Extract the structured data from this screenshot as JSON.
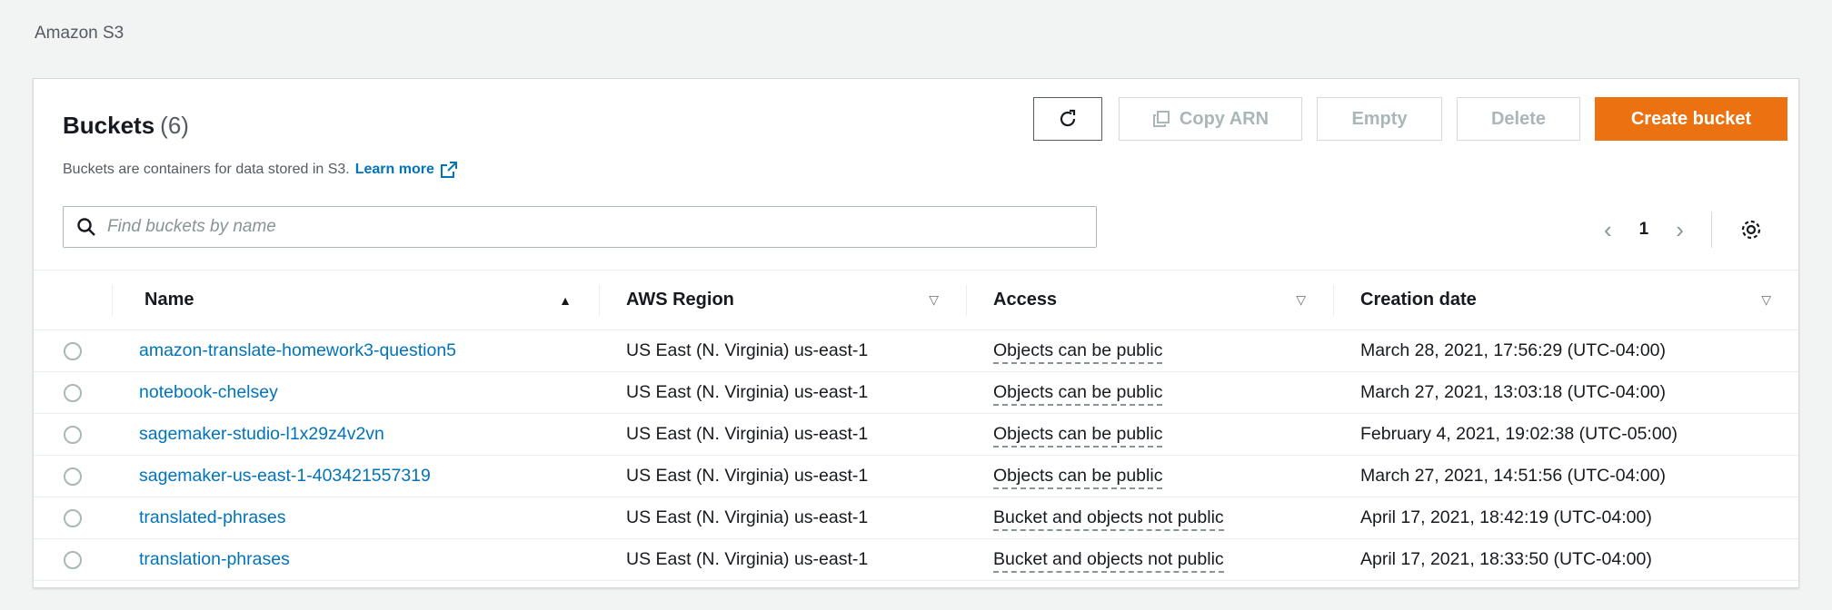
{
  "breadcrumb": "Amazon S3",
  "header": {
    "title": "Buckets",
    "count": "(6)",
    "description": "Buckets are containers for data stored in S3.",
    "learn_more": "Learn more"
  },
  "toolbar": {
    "refresh_icon": "refresh-icon",
    "copy_arn_label": "Copy ARN",
    "empty_label": "Empty",
    "delete_label": "Delete",
    "create_label": "Create bucket"
  },
  "search": {
    "placeholder": "Find buckets by name",
    "value": ""
  },
  "pagination": {
    "current_page": "1"
  },
  "table": {
    "columns": [
      "Name",
      "AWS Region",
      "Access",
      "Creation date"
    ],
    "rows": [
      {
        "name": "amazon-translate-homework3-question5",
        "region": "US East (N. Virginia) us-east-1",
        "access": "Objects can be public",
        "created": "March 28, 2021, 17:56:29 (UTC-04:00)"
      },
      {
        "name": "notebook-chelsey",
        "region": "US East (N. Virginia) us-east-1",
        "access": "Objects can be public",
        "created": "March 27, 2021, 13:03:18 (UTC-04:00)"
      },
      {
        "name": "sagemaker-studio-l1x29z4v2vn",
        "region": "US East (N. Virginia) us-east-1",
        "access": "Objects can be public",
        "created": "February 4, 2021, 19:02:38 (UTC-05:00)"
      },
      {
        "name": "sagemaker-us-east-1-403421557319",
        "region": "US East (N. Virginia) us-east-1",
        "access": "Objects can be public",
        "created": "March 27, 2021, 14:51:56 (UTC-04:00)"
      },
      {
        "name": "translated-phrases",
        "region": "US East (N. Virginia) us-east-1",
        "access": "Bucket and objects not public",
        "created": "April 17, 2021, 18:42:19 (UTC-04:00)"
      },
      {
        "name": "translation-phrases",
        "region": "US East (N. Virginia) us-east-1",
        "access": "Bucket and objects not public",
        "created": "April 17, 2021, 18:33:50 (UTC-04:00)"
      }
    ]
  },
  "colors": {
    "primary": "#ec7211",
    "link": "#0073bb",
    "background": "#f2f3f3"
  }
}
